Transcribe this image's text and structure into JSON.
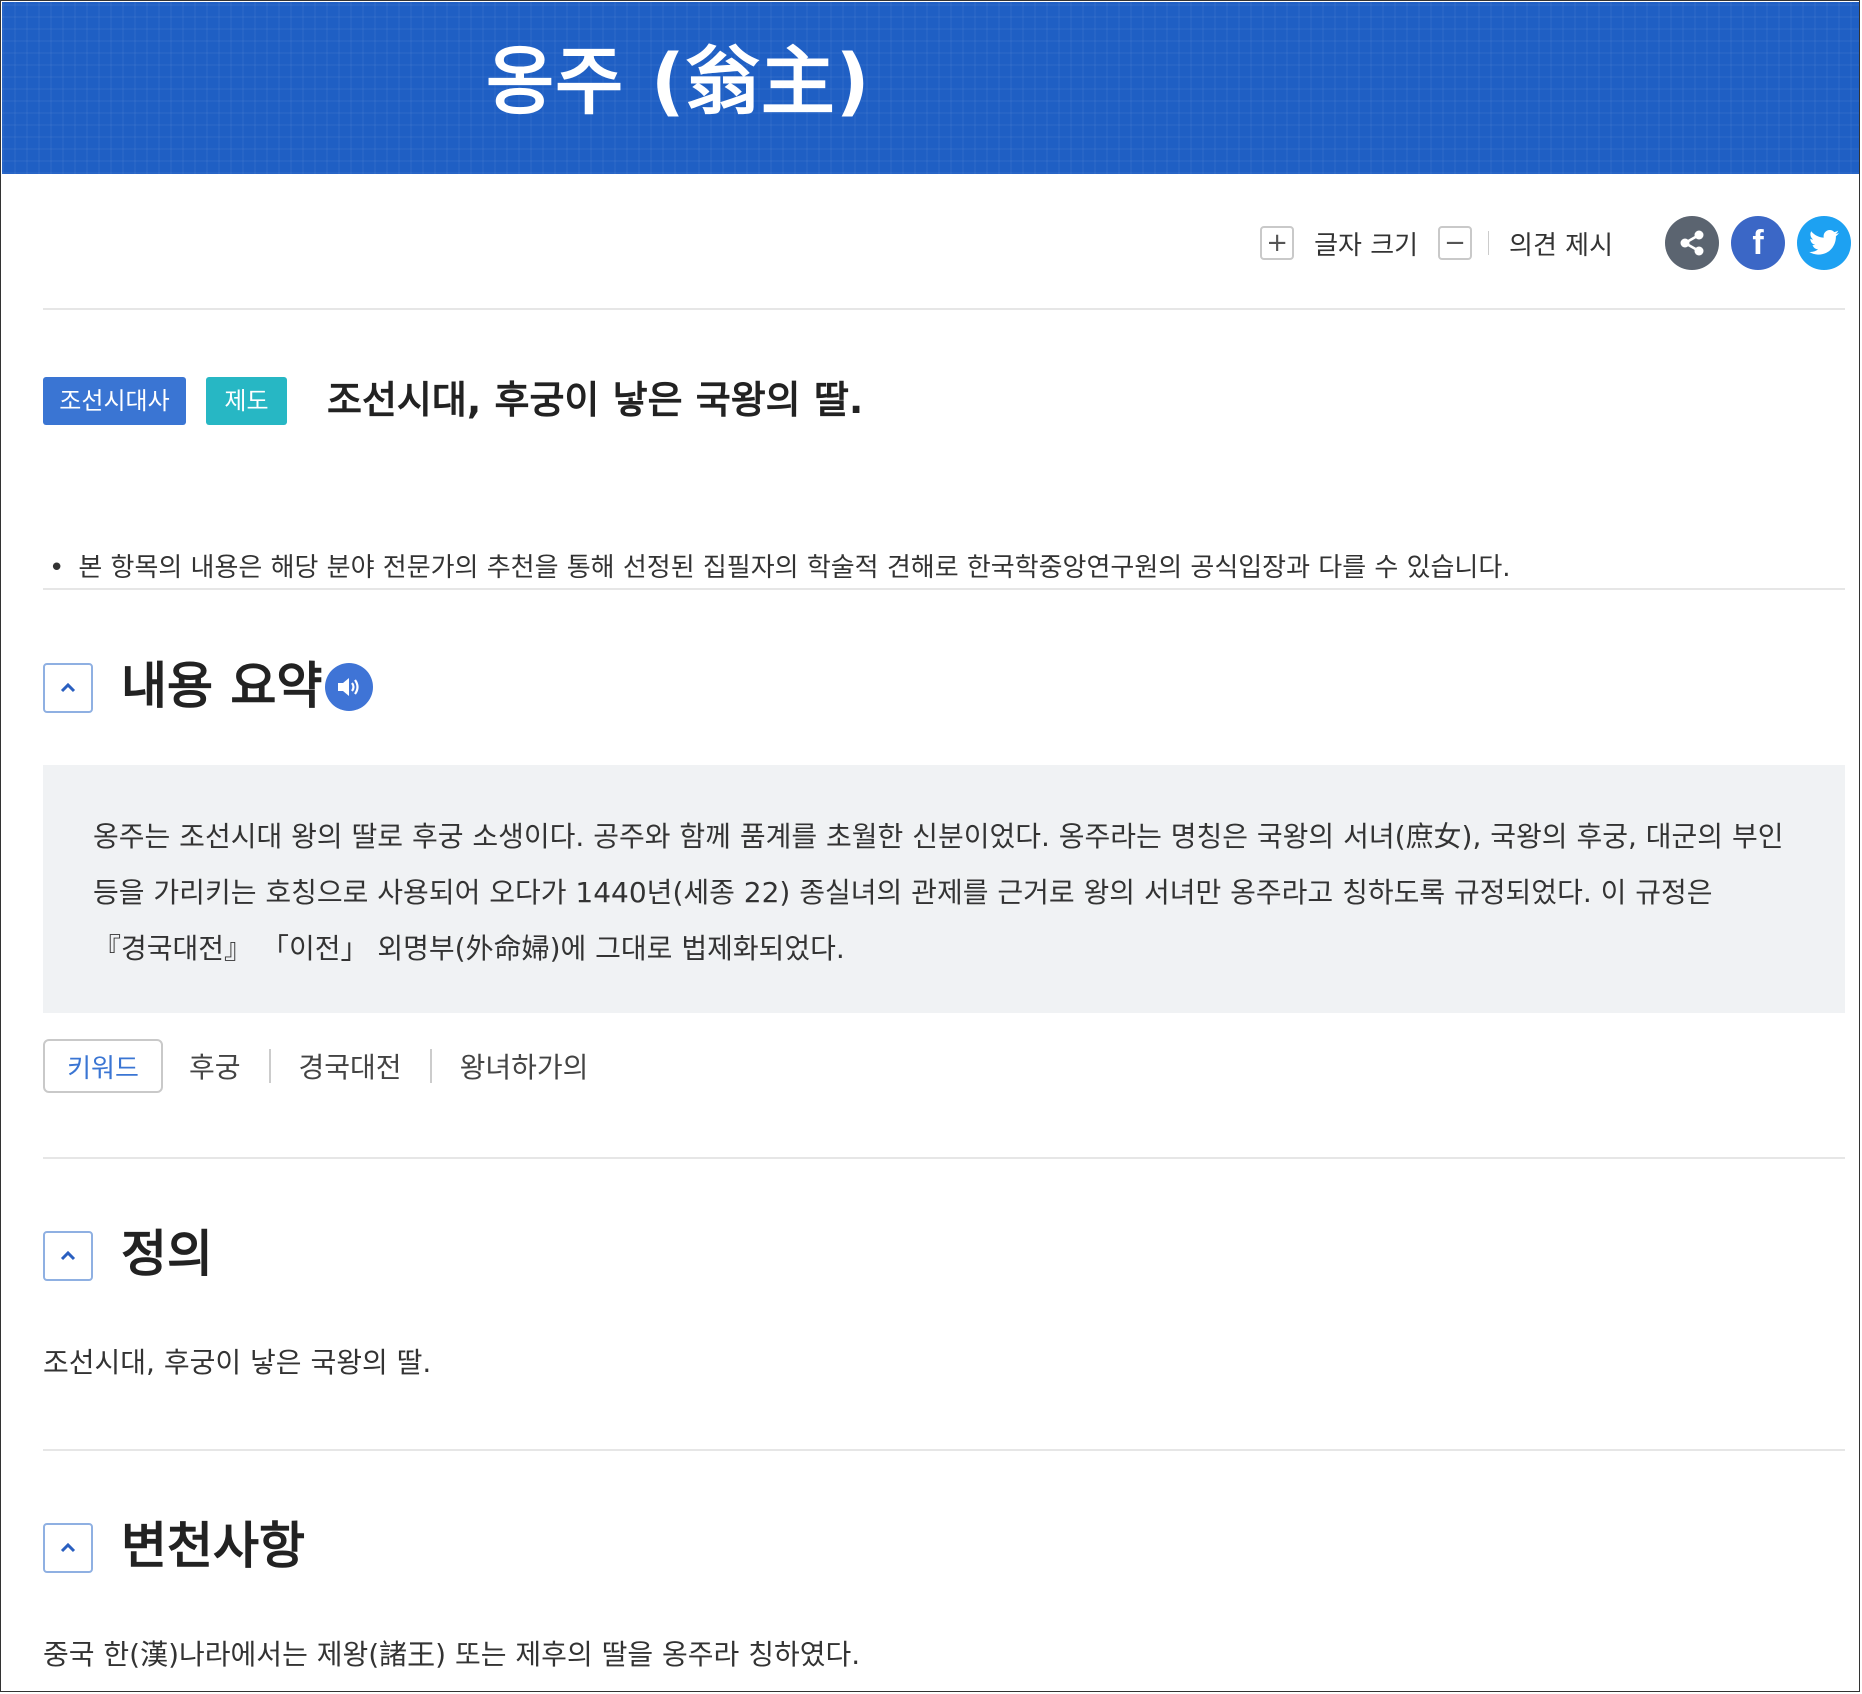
{
  "header": {
    "title": "옹주 (翁主)"
  },
  "toolbar": {
    "plus": "+",
    "font_size_label": "글자 크기",
    "minus": "−",
    "opinion_label": "의견 제시",
    "facebook_glyph": "f"
  },
  "tags": [
    "조선시대사",
    "제도"
  ],
  "subtitle": "조선시대, 후궁이 낳은 국왕의 딸.",
  "notice": {
    "bullet": "•",
    "text": "본 항목의 내용은 해당 분야 전문가의 추천을 통해 선정된 집필자의 학술적 견해로 한국학중앙연구원의 공식입장과 다를 수 있습니다."
  },
  "summary": {
    "title": "내용 요약",
    "text": "옹주는 조선시대 왕의 딸로 후궁 소생이다. 공주와 함께 품계를 초월한 신분이었다. 옹주라는 명칭은 국왕의 서녀(庶女), 국왕의 후궁, 대군의 부인 등을 가리키는 호칭으로 사용되어 오다가 1440년(세종 22) 종실녀의 관제를 근거로 왕의 서녀만 옹주라고 칭하도록 규정되었다. 이 규정은 『경국대전』 「이전」 외명부(外命婦)에 그대로 법제화되었다."
  },
  "keywords": {
    "label": "키워드",
    "items": [
      "후궁",
      "경국대전",
      "왕녀하가의"
    ]
  },
  "definition": {
    "title": "정의",
    "text": "조선시대, 후궁이 낳은 국왕의 딸."
  },
  "history": {
    "title": "변천사항",
    "text": "중국 한(漢)나라에서는 제왕(諸王) 또는 제후의 딸을 옹주라 칭하였다."
  }
}
